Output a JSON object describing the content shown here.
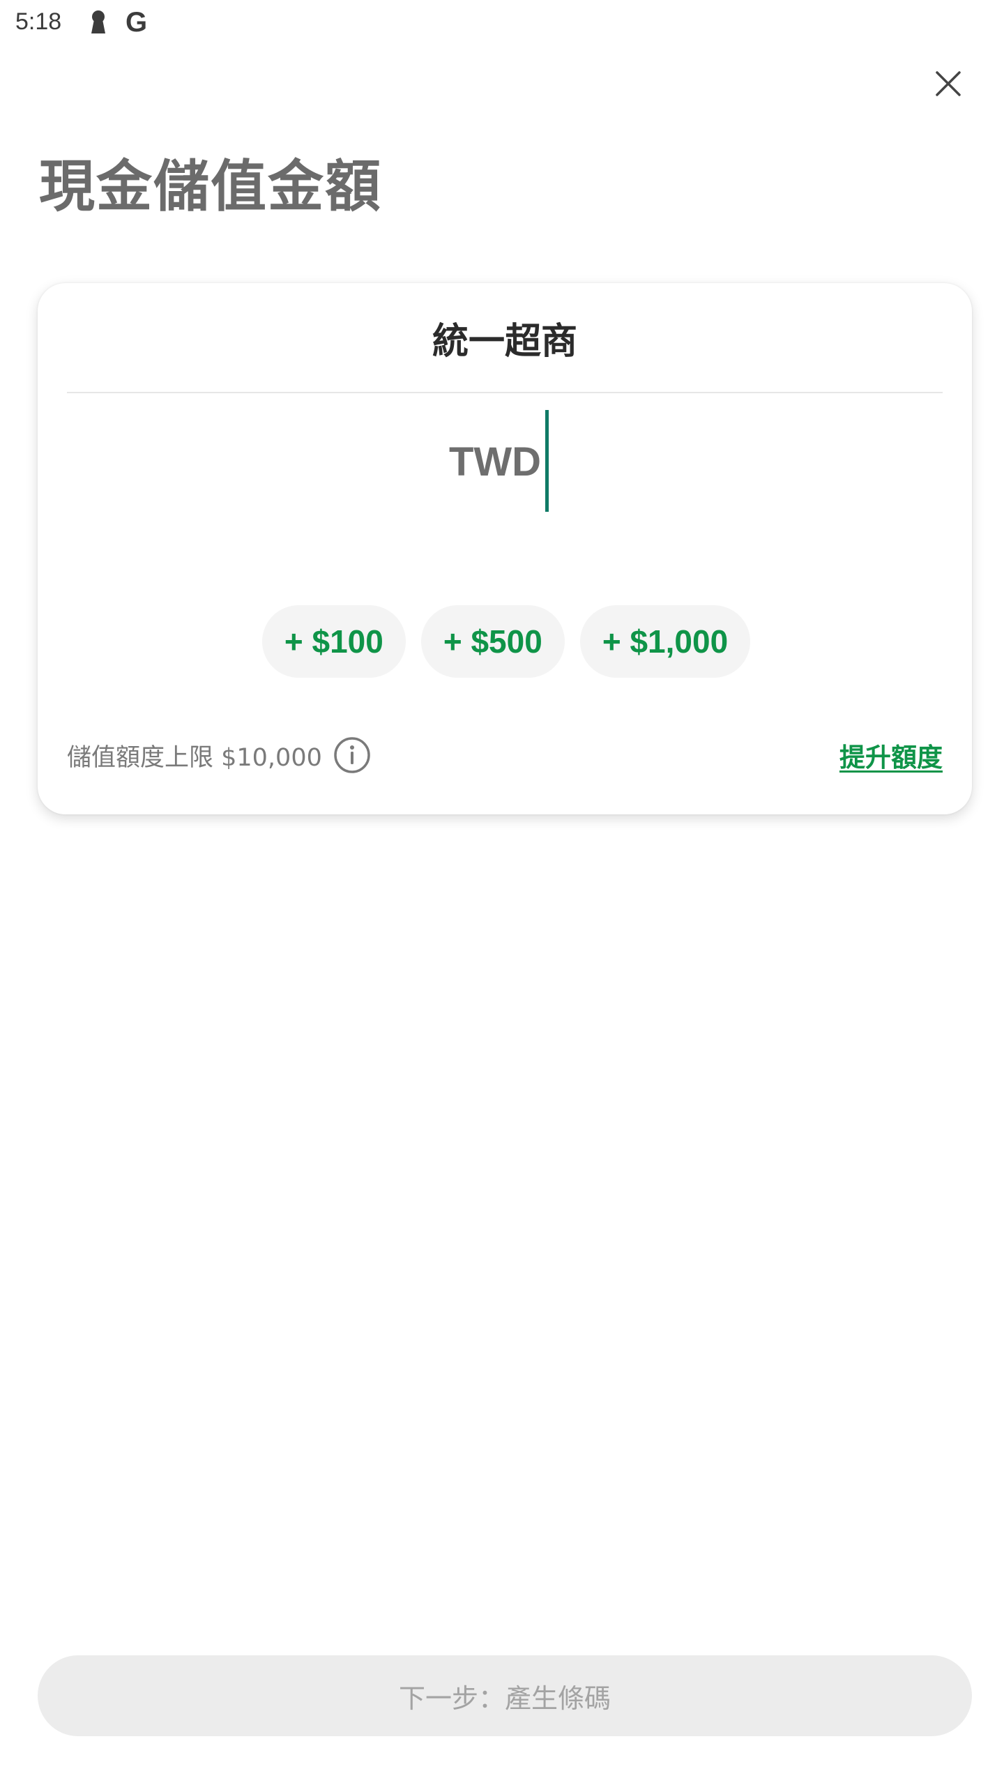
{
  "status_bar": {
    "time": "5:18",
    "icons": [
      "keyhole-icon",
      "google-g-icon"
    ],
    "google_glyph": "G"
  },
  "header": {
    "close_icon": "close-icon",
    "title": "現金儲值金額"
  },
  "card": {
    "store_name": "統一超商",
    "currency": "TWD",
    "amount_value": "",
    "caret_color": "#0f7a66",
    "quick_add_chips": [
      {
        "label": "+ $100"
      },
      {
        "label": "+ $500"
      },
      {
        "label": "+ $1,000"
      }
    ],
    "limit_text": "儲值額度上限 $10,000",
    "info_icon": "info-icon",
    "raise_limit_label": "提升額度"
  },
  "footer": {
    "next_button_label": "下一步：產生條碼"
  },
  "colors": {
    "accent_green": "#0f9448",
    "title_gray": "#6b6b6b",
    "chip_bg": "#f4f4f4",
    "disabled_button_bg": "#ececec",
    "disabled_button_text": "#a3a3a3"
  }
}
